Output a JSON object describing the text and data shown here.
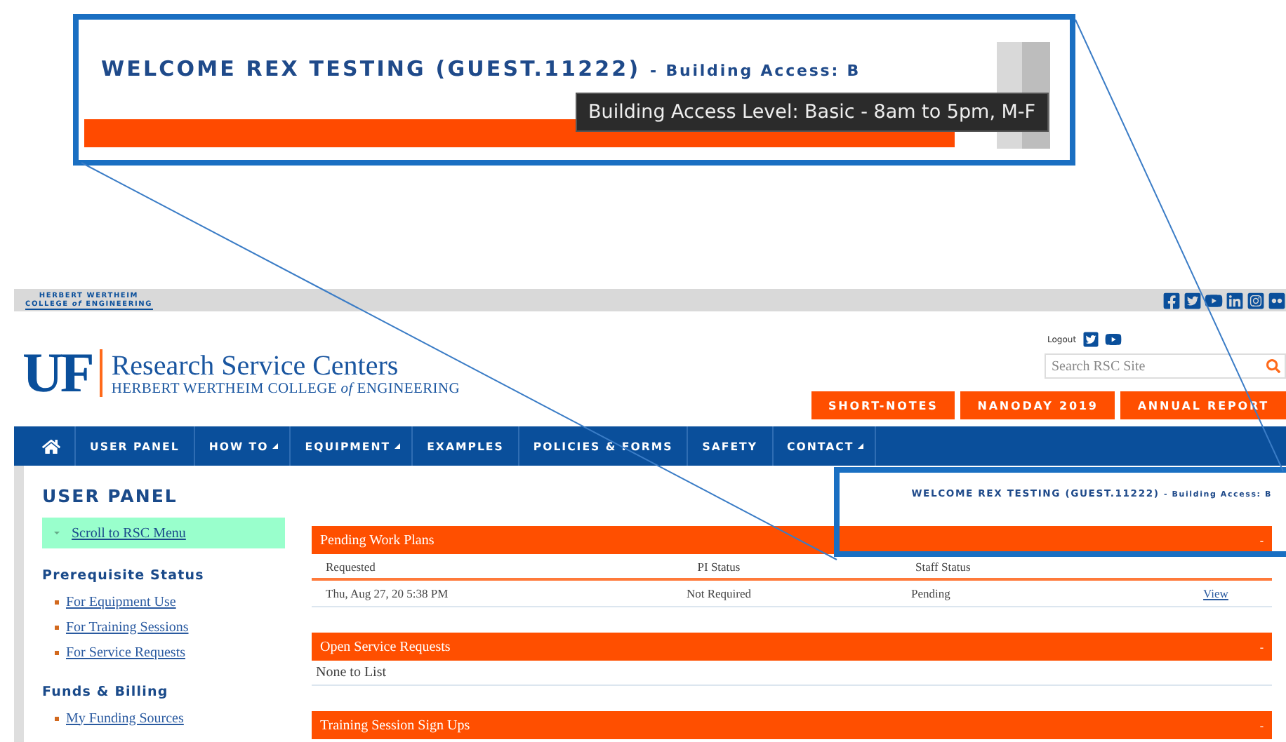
{
  "callout": {
    "welcome": "WELCOME REX TESTING (GUEST.11222)",
    "access": "- Building Access: B",
    "tooltip": "Building Access Level: Basic - 8am to 5pm, M-F"
  },
  "top_bar": {
    "college_line_1": "HERBERT WERTHEIM",
    "college_line_2": "COLLEGE *of* ENGINEERING"
  },
  "header": {
    "logo": "UF",
    "title": "Research Service Centers",
    "subtitle": "HERBERT WERTHEIM COLLEGE *of* ENGINEERING",
    "logout": "Logout",
    "search": {
      "placeholder": "Search RSC Site"
    },
    "buttons": [
      "SHORT-NOTES",
      "NANODAY 2019",
      "ANNUAL REPORT"
    ]
  },
  "nav": [
    {
      "kind": "home"
    },
    {
      "kind": "text",
      "label": "USER PANEL",
      "dropdown": false
    },
    {
      "kind": "text",
      "label": "HOW TO",
      "dropdown": true
    },
    {
      "kind": "text",
      "label": "EQUIPMENT",
      "dropdown": true
    },
    {
      "kind": "text",
      "label": "EXAMPLES",
      "dropdown": false
    },
    {
      "kind": "text",
      "label": "POLICIES & FORMS",
      "dropdown": false
    },
    {
      "kind": "text",
      "label": "SAFETY",
      "dropdown": false
    },
    {
      "kind": "text",
      "label": "CONTACT",
      "dropdown": true
    }
  ],
  "user_panel": {
    "title": "USER PANEL",
    "welcome": "WELCOME REX TESTING (GUEST.11222)",
    "access": "- Building Access: B",
    "scroll_link": "Scroll to RSC Menu",
    "sections": [
      {
        "title": "Prerequisite Status",
        "links": [
          "For Equipment Use",
          "For Training Sessions",
          "For Service Requests"
        ]
      },
      {
        "title": "Funds & Billing",
        "links": [
          "My Funding Sources"
        ]
      }
    ]
  },
  "panels": [
    {
      "title": "Pending Work Plans",
      "toggle": "-",
      "columns": [
        "Requested",
        "PI Status",
        "Staff Status"
      ],
      "rows": [
        {
          "requested": "Thu, Aug 27, 20 5:38 PM",
          "pi_status": "Not Required",
          "staff_status": "Pending",
          "action": "View"
        }
      ]
    },
    {
      "title": "Open Service Requests",
      "toggle": "-",
      "empty": "None to List"
    },
    {
      "title": "Training Session Sign Ups",
      "toggle": "-"
    }
  ]
}
